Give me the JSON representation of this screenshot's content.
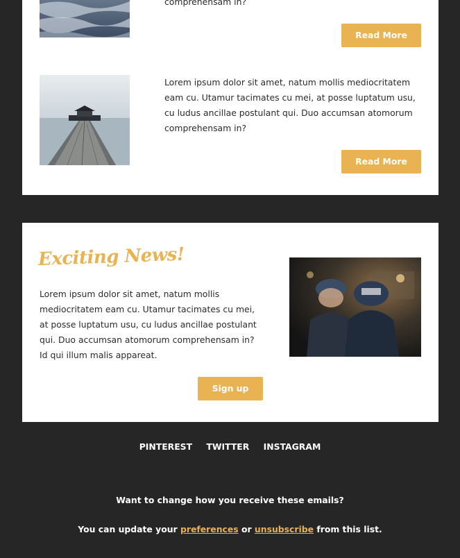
{
  "articles": [
    {
      "image": "ocean-waves-photo",
      "text": "comprehensam in?",
      "button": "Read More"
    },
    {
      "image": "pier-gazebo-photo",
      "text": "Lorem ipsum dolor sit amet, natum mollis mediocritatem eam cu. Utamur tacimates cu mei, at posse luptatum usu, cu ludus ancillae postulant qui. Duo accumsan atomorum comprehensam in?",
      "button": "Read More"
    }
  ],
  "news": {
    "title": "Exciting News!",
    "body": "Lorem ipsum dolor sit amet, natum mollis mediocritatem eam cu. Utamur tacimates cu mei, at posse luptatum usu, cu ludus ancillae postulant qui. Duo accumsan atomorum comprehensam in? Id qui illum malis appareat.",
    "image": "portland-cap-restaurant-photo",
    "button": "Sign up"
  },
  "social": [
    "PINTEREST",
    "TWITTER",
    "INSTAGRAM"
  ],
  "footer": {
    "question": "Want to change how you receive these emails?",
    "update_prefix": "You can update your",
    "preferences_link": "preferences",
    "or": "or",
    "unsubscribe_link": "unsubscribe",
    "update_suffix": "from this list."
  },
  "colors": {
    "background": "#262626",
    "accent": "#e9b253",
    "panel": "#ffffff"
  }
}
